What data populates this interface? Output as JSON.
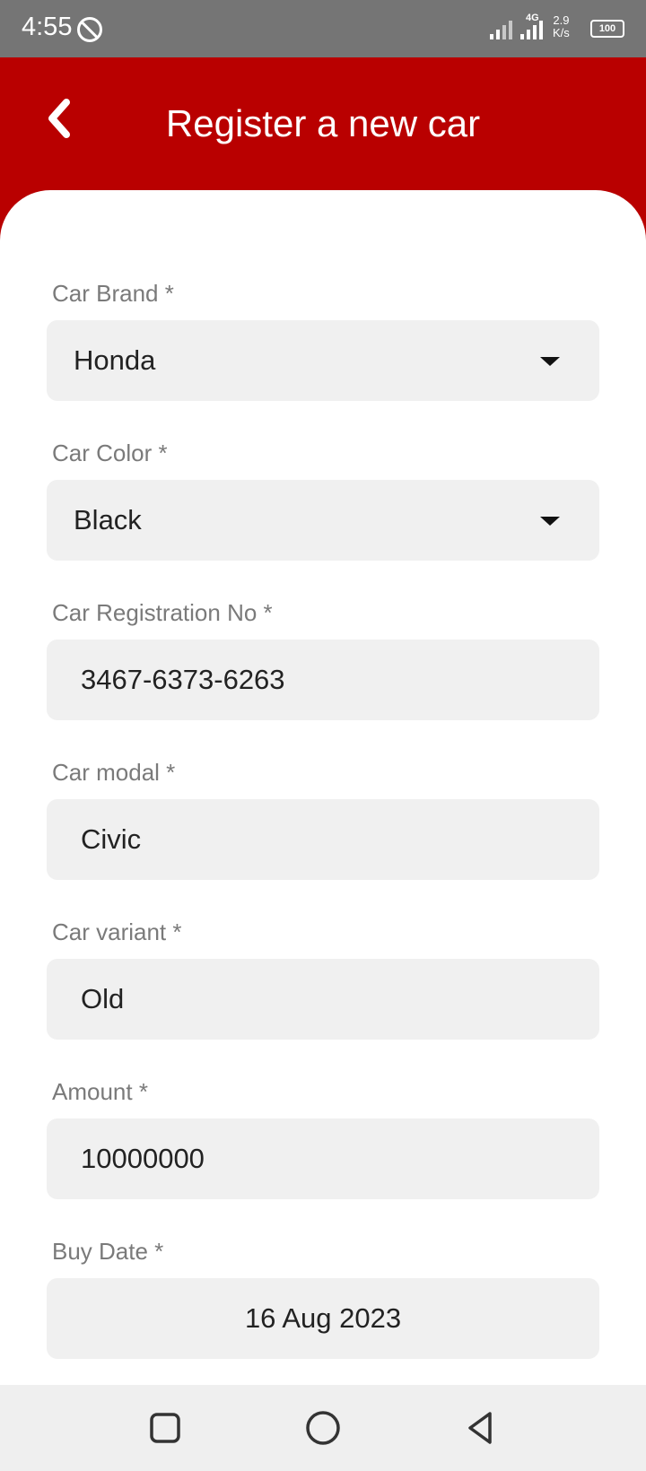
{
  "status_bar": {
    "time": "4:55",
    "network": "4G",
    "speed_value": "2.9",
    "speed_unit": "K/s",
    "battery": "100"
  },
  "header": {
    "title": "Register a new car",
    "background_color": "#b90000"
  },
  "form": {
    "brand": {
      "label": "Car Brand *",
      "value": "Honda"
    },
    "color": {
      "label": "Car Color *",
      "value": "Black"
    },
    "registration": {
      "label": "Car Registration No *",
      "value": "3467-6373-6263"
    },
    "model": {
      "label": "Car modal *",
      "value": "Civic"
    },
    "variant": {
      "label": "Car variant *",
      "value": "Old"
    },
    "amount": {
      "label": "Amount *",
      "value": "10000000"
    },
    "buy_date": {
      "label": "Buy Date *",
      "value": "16 Aug 2023"
    }
  },
  "nav_bar": {
    "icons": [
      "recents-square-icon",
      "home-circle-icon",
      "back-triangle-icon"
    ]
  }
}
